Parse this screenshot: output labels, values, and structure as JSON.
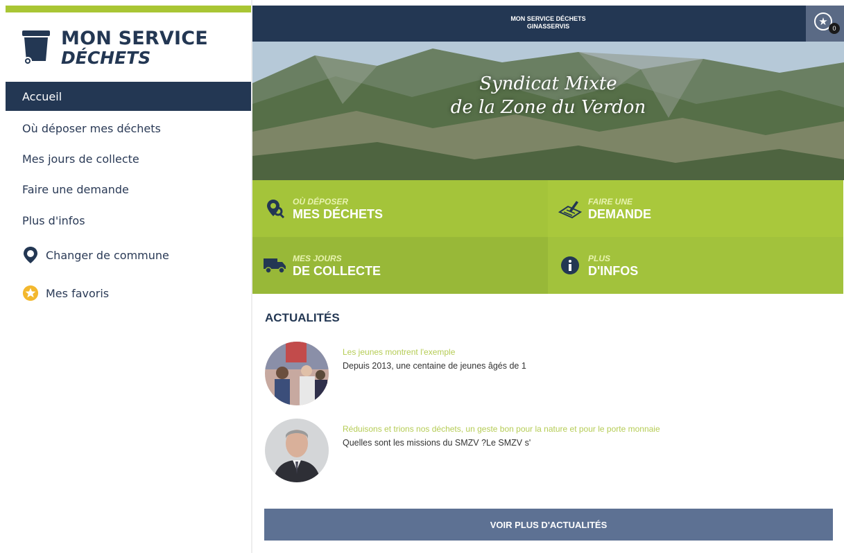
{
  "app": {
    "title_line1": "MON SERVICE",
    "title_line2": "DÉCHETS"
  },
  "sidebar": {
    "items": [
      {
        "label": "Accueil",
        "active": true
      },
      {
        "label": "Où déposer mes déchets"
      },
      {
        "label": "Mes jours de collecte"
      },
      {
        "label": "Faire une demande"
      },
      {
        "label": "Plus d'infos"
      },
      {
        "label": "Changer de commune",
        "icon": "map-pin-icon"
      },
      {
        "label": "Mes favoris",
        "icon": "star-icon"
      }
    ]
  },
  "header": {
    "line1": "MON SERVICE DÉCHETS",
    "line2": "GINASSERVIS",
    "favorites_count": "0"
  },
  "hero": {
    "line1": "Syndicat Mixte",
    "line2": "de la Zone du Verdon"
  },
  "tiles": [
    {
      "line1": "OÙ DÉPOSER",
      "line2": "MES DÉCHETS",
      "icon": "map-search-icon"
    },
    {
      "line1": "FAIRE UNE",
      "line2": "DEMANDE",
      "icon": "form-pen-icon"
    },
    {
      "line1": "MES JOURS",
      "line2": "DE COLLECTE",
      "icon": "truck-icon"
    },
    {
      "line1": "PLUS",
      "line2": "D'INFOS",
      "icon": "info-icon"
    }
  ],
  "news": {
    "heading": "ACTUALITÉS",
    "items": [
      {
        "title": "Les jeunes montrent l'exemple",
        "text": "Depuis 2013, une centaine de jeunes âgés de 1"
      },
      {
        "title": "Réduisons et trions nos déchets, un geste bon pour la nature et pour le porte monnaie",
        "text": "Quelles sont les missions du SMZV ?Le SMZV s'"
      }
    ],
    "more_label": "VOIR PLUS D'ACTUALITÉS"
  },
  "colors": {
    "navy": "#233753",
    "green": "#a4c43a",
    "button": "#5d7193"
  }
}
